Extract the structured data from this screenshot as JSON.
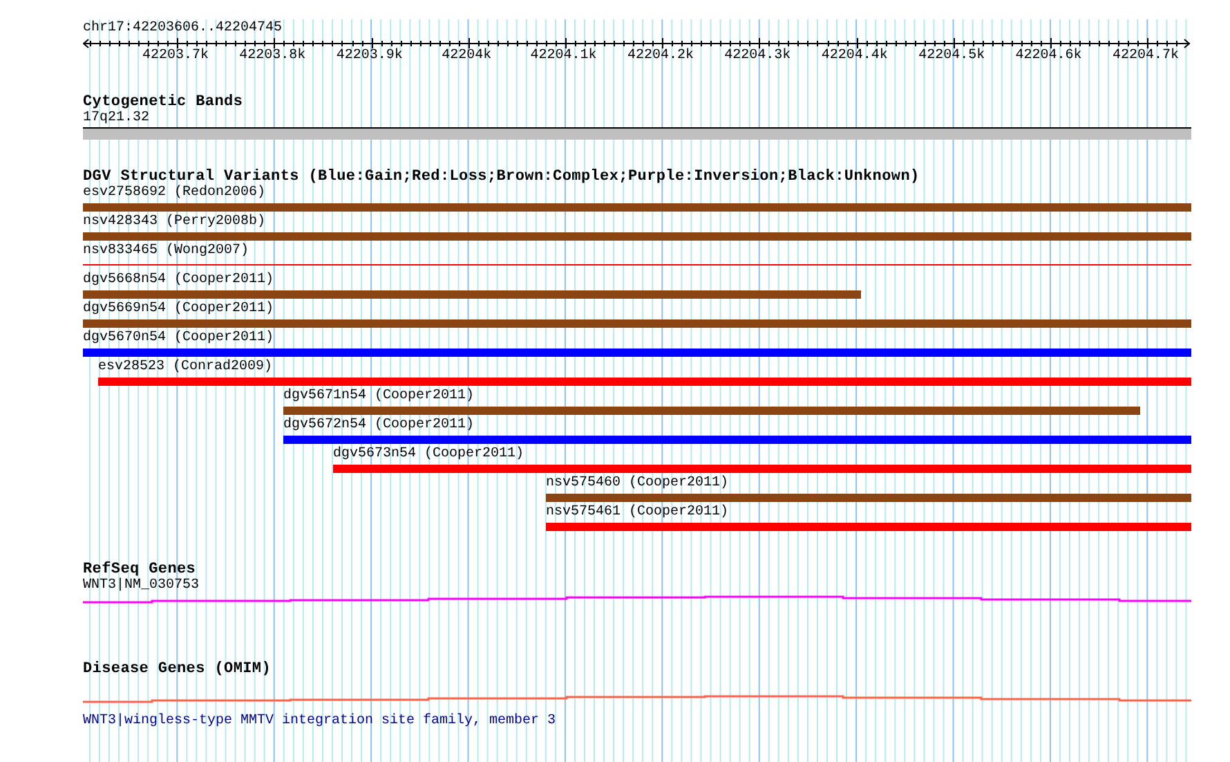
{
  "ruler": {
    "title": "chr17:42203606..42204745",
    "ticks": [
      "42203.7k",
      "42203.8k",
      "42203.9k",
      "42204k",
      "42204.1k",
      "42204.2k",
      "42204.3k",
      "42204.4k",
      "42204.5k",
      "42204.6k",
      "42204.7k"
    ]
  },
  "cytoband": {
    "title": "Cytogenetic Bands",
    "label": "17q21.32"
  },
  "variants": {
    "title": "DGV Structural Variants (Blue:Gain;Red:Loss;Brown:Complex;Purple:Inversion;Black:Unknown)",
    "items": [
      {
        "label": "esv2758692 (Redon2006)",
        "color": "#8b4513",
        "kind": "bar"
      },
      {
        "label": "nsv428343 (Perry2008b)",
        "color": "#8b4513",
        "kind": "bar"
      },
      {
        "label": "nsv833465 (Wong2007)",
        "color": "#ff0000",
        "kind": "line"
      },
      {
        "label": "dgv5668n54 (Cooper2011)",
        "color": "#8b4513",
        "kind": "bar"
      },
      {
        "label": "dgv5669n54 (Cooper2011)",
        "color": "#8b4513",
        "kind": "bar"
      },
      {
        "label": "dgv5670n54 (Cooper2011)",
        "color": "#0000ff",
        "kind": "bar"
      },
      {
        "label": "esv28523 (Conrad2009)",
        "color": "#ff0000",
        "kind": "bar"
      },
      {
        "label": "dgv5671n54 (Cooper2011)",
        "color": "#8b4513",
        "kind": "bar"
      },
      {
        "label": "dgv5672n54 (Cooper2011)",
        "color": "#0000ff",
        "kind": "bar"
      },
      {
        "label": "dgv5673n54 (Cooper2011)",
        "color": "#ff0000",
        "kind": "bar"
      },
      {
        "label": "nsv575460 (Cooper2011)",
        "color": "#8b4513",
        "kind": "bar"
      },
      {
        "label": "nsv575461 (Cooper2011)",
        "color": "#ff0000",
        "kind": "bar"
      }
    ]
  },
  "refseq": {
    "title": "RefSeq Genes",
    "label": "WNT3|NM_030753"
  },
  "omim": {
    "title": "Disease Genes (OMIM)",
    "description": "WNT3|wingless-type MMTV integration site family, member 3"
  }
}
